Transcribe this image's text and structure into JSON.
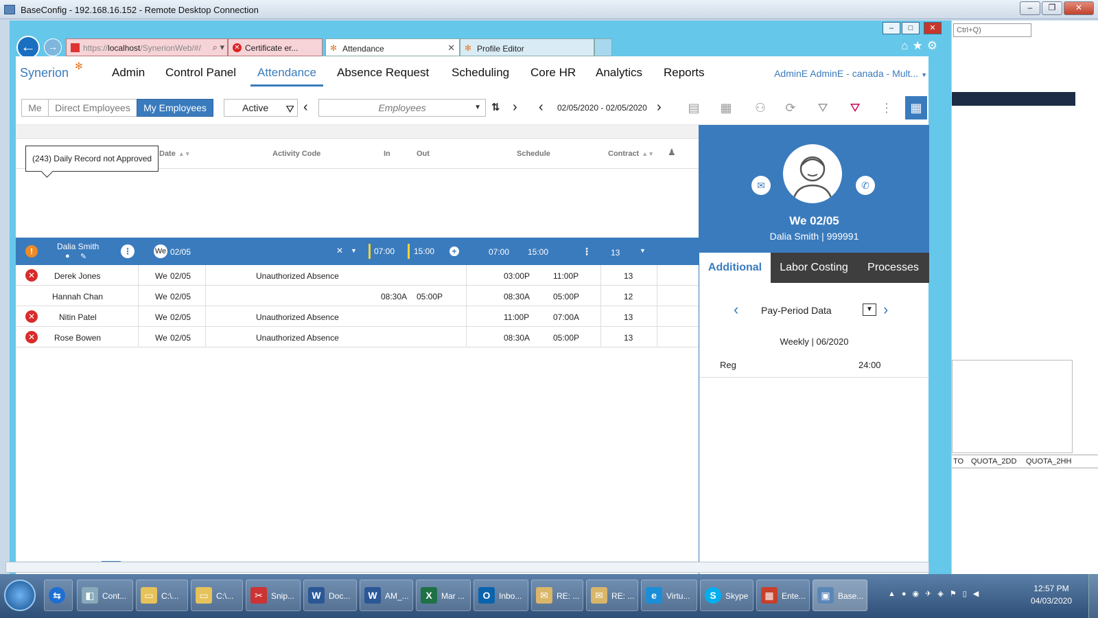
{
  "rdp": {
    "title": "BaseConfig - 192.168.16.152 - Remote Desktop Connection"
  },
  "browser": {
    "url_prefix": "https://",
    "url_host": "localhost",
    "url_rest": "/SynerionWeb/#/",
    "cert_tab": "Certificate er...",
    "tabs": [
      {
        "label": "Attendance",
        "active": true
      },
      {
        "label": "Profile Editor",
        "active": false
      }
    ]
  },
  "app": {
    "brand": "Synerion",
    "nav": [
      "Admin",
      "Control Panel",
      "Attendance",
      "Absence Request",
      "Scheduling",
      "Core HR",
      "Analytics",
      "Reports"
    ],
    "user": "AdminE AdminE - canada - Mult...",
    "toolbar": {
      "scope": [
        "Me",
        "Direct Employees",
        "My Employees"
      ],
      "scope_selected": "My Employees",
      "status_filter": "Active",
      "employee_placeholder": "Employees",
      "date_range": "02/05/2020 - 02/05/2020"
    },
    "grid": {
      "tooltip": "(243) Daily Record not Approved",
      "headers": {
        "date": "Date",
        "activity": "Activity Code",
        "in": "In",
        "out": "Out",
        "schedule": "Schedule",
        "contract": "Contract"
      },
      "selected": {
        "name": "Dalia Smith",
        "day": "We",
        "date": "02/05",
        "in": "07:00",
        "out": "15:00",
        "sched_in": "07:00",
        "sched_out": "15:00",
        "contract": "13"
      },
      "rows": [
        {
          "status": "error",
          "name": "Derek Jones",
          "day": "We",
          "date": "02/05",
          "activity": "Unauthorized Absence",
          "in": "",
          "out": "",
          "sched_in": "03:00P",
          "sched_out": "11:00P",
          "contract": "13"
        },
        {
          "status": "none",
          "name": "Hannah Chan",
          "day": "We",
          "date": "02/05",
          "activity": "",
          "in": "08:30A",
          "out": "05:00P",
          "sched_in": "08:30A",
          "sched_out": "05:00P",
          "contract": "12"
        },
        {
          "status": "error",
          "name": "Nitin Patel",
          "day": "We",
          "date": "02/05",
          "activity": "Unauthorized Absence",
          "in": "",
          "out": "",
          "sched_in": "11:00P",
          "sched_out": "07:00A",
          "contract": "13"
        },
        {
          "status": "error",
          "name": "Rose Bowen",
          "day": "We",
          "date": "02/05",
          "activity": "Unauthorized Absence",
          "in": "",
          "out": "",
          "sched_in": "08:30A",
          "sched_out": "05:00P",
          "contract": "13"
        }
      ]
    },
    "side": {
      "date": "We 02/05",
      "employee": "Dalia Smith | 999991",
      "tabs": [
        "Additional",
        "Labor Costing",
        "Processes"
      ],
      "tab_selected": "Additional",
      "period_label": "Pay-Period Data",
      "period": "Weekly | 06/2020",
      "reg_label": "Reg",
      "reg_value": "24:00"
    }
  },
  "bgapp": {
    "search_placeholder": "Ctrl+Q)",
    "cols": [
      "TO",
      "QUOTA_2DD",
      "QUOTA_2HH"
    ]
  },
  "taskbar": {
    "items": [
      "Cont...",
      "C:\\...",
      "C:\\...",
      "Snip...",
      "Doc...",
      "AM_...",
      "Mar ...",
      "Inbo...",
      "RE: ...",
      "RE: ...",
      "Virtu...",
      "Skype",
      "Ente...",
      "Base..."
    ],
    "time": "12:57 PM",
    "date": "04/03/2020"
  },
  "colors": {
    "accent": "#3a7bbd",
    "error": "#d92b2b",
    "warning": "#f08a24",
    "brand_spark": "#e57826"
  }
}
